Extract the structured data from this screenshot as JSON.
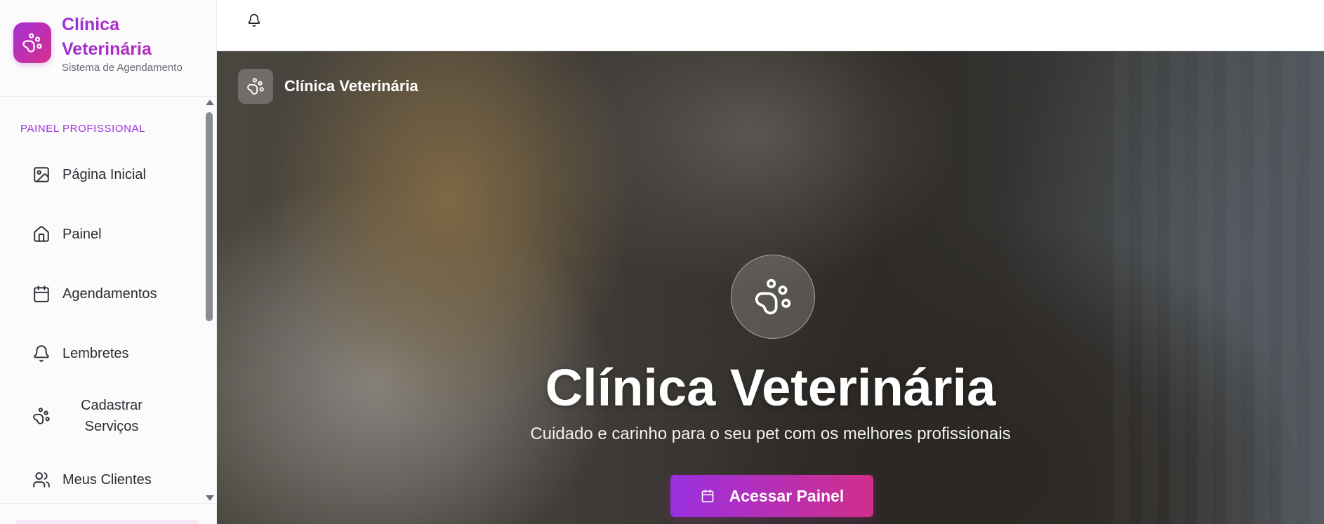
{
  "brand": {
    "title": "Clínica Veterinária",
    "subtitle": "Sistema de Agendamento",
    "accent_start": "#a431d6",
    "accent_end": "#d6308c"
  },
  "sidebar": {
    "section_label": "PAINEL PROFISSIONAL",
    "items": [
      {
        "label": "Página Inicial",
        "icon": "image-icon"
      },
      {
        "label": "Painel",
        "icon": "home-icon"
      },
      {
        "label": "Agendamentos",
        "icon": "calendar-icon"
      },
      {
        "label": "Lembretes",
        "icon": "bell-icon"
      },
      {
        "label": "Cadastrar Serviços",
        "icon": "paw-icon"
      },
      {
        "label": "Meus Clientes",
        "icon": "users-icon"
      }
    ]
  },
  "header": {
    "notifications_icon": "bell-icon"
  },
  "hero": {
    "brand_name": "Clínica Veterinária",
    "title": "Clínica Veterinária",
    "subtitle": "Cuidado e carinho para o seu pet com os melhores profissionais",
    "cta_label": "Acessar Painel",
    "cta_icon": "calendar-icon"
  }
}
